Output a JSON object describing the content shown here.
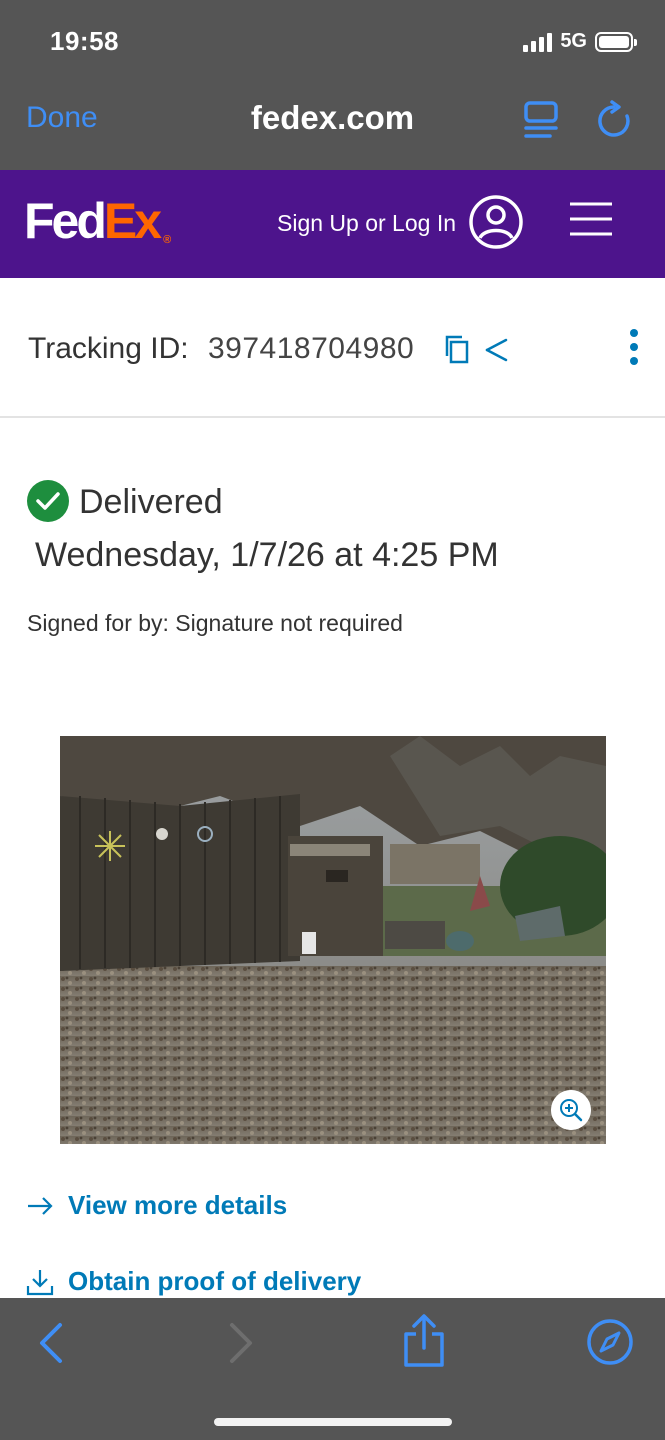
{
  "status_bar": {
    "time": "19:58",
    "network": "5G"
  },
  "browser": {
    "done_label": "Done",
    "domain": "fedex.com",
    "accent_color": "#3f8ef5"
  },
  "fedex_header": {
    "logo_fed": "Fed",
    "logo_ex": "Ex",
    "logo_reg": "®",
    "signup_label": "Sign Up or Log In",
    "brand_purple": "#4d148c",
    "brand_orange": "#ff6600"
  },
  "tracking": {
    "label": "Tracking ID:",
    "number": "397418704980"
  },
  "delivery": {
    "status": "Delivered",
    "date": "Wednesday, 1/7/26 at 4:25 PM",
    "signed_for": "Signed for by: Signature not required",
    "status_color": "#1e8e3e"
  },
  "links": {
    "view_details": "View more details",
    "proof_of_delivery": "Obtain proof of delivery",
    "link_color": "#007ab7"
  },
  "icons": {
    "reader": "reader-icon",
    "reload": "reload-icon",
    "account": "account-icon",
    "menu": "hamburger-menu-icon",
    "copy": "copy-icon",
    "share": "share-icon",
    "more": "more-vertical-icon",
    "check": "check-circle-icon",
    "zoom": "zoom-in-icon",
    "arrow_right": "arrow-right-icon",
    "download": "download-icon",
    "back": "chevron-left-icon",
    "forward": "chevron-right-icon",
    "share_page": "share-page-icon",
    "compass": "compass-icon"
  }
}
